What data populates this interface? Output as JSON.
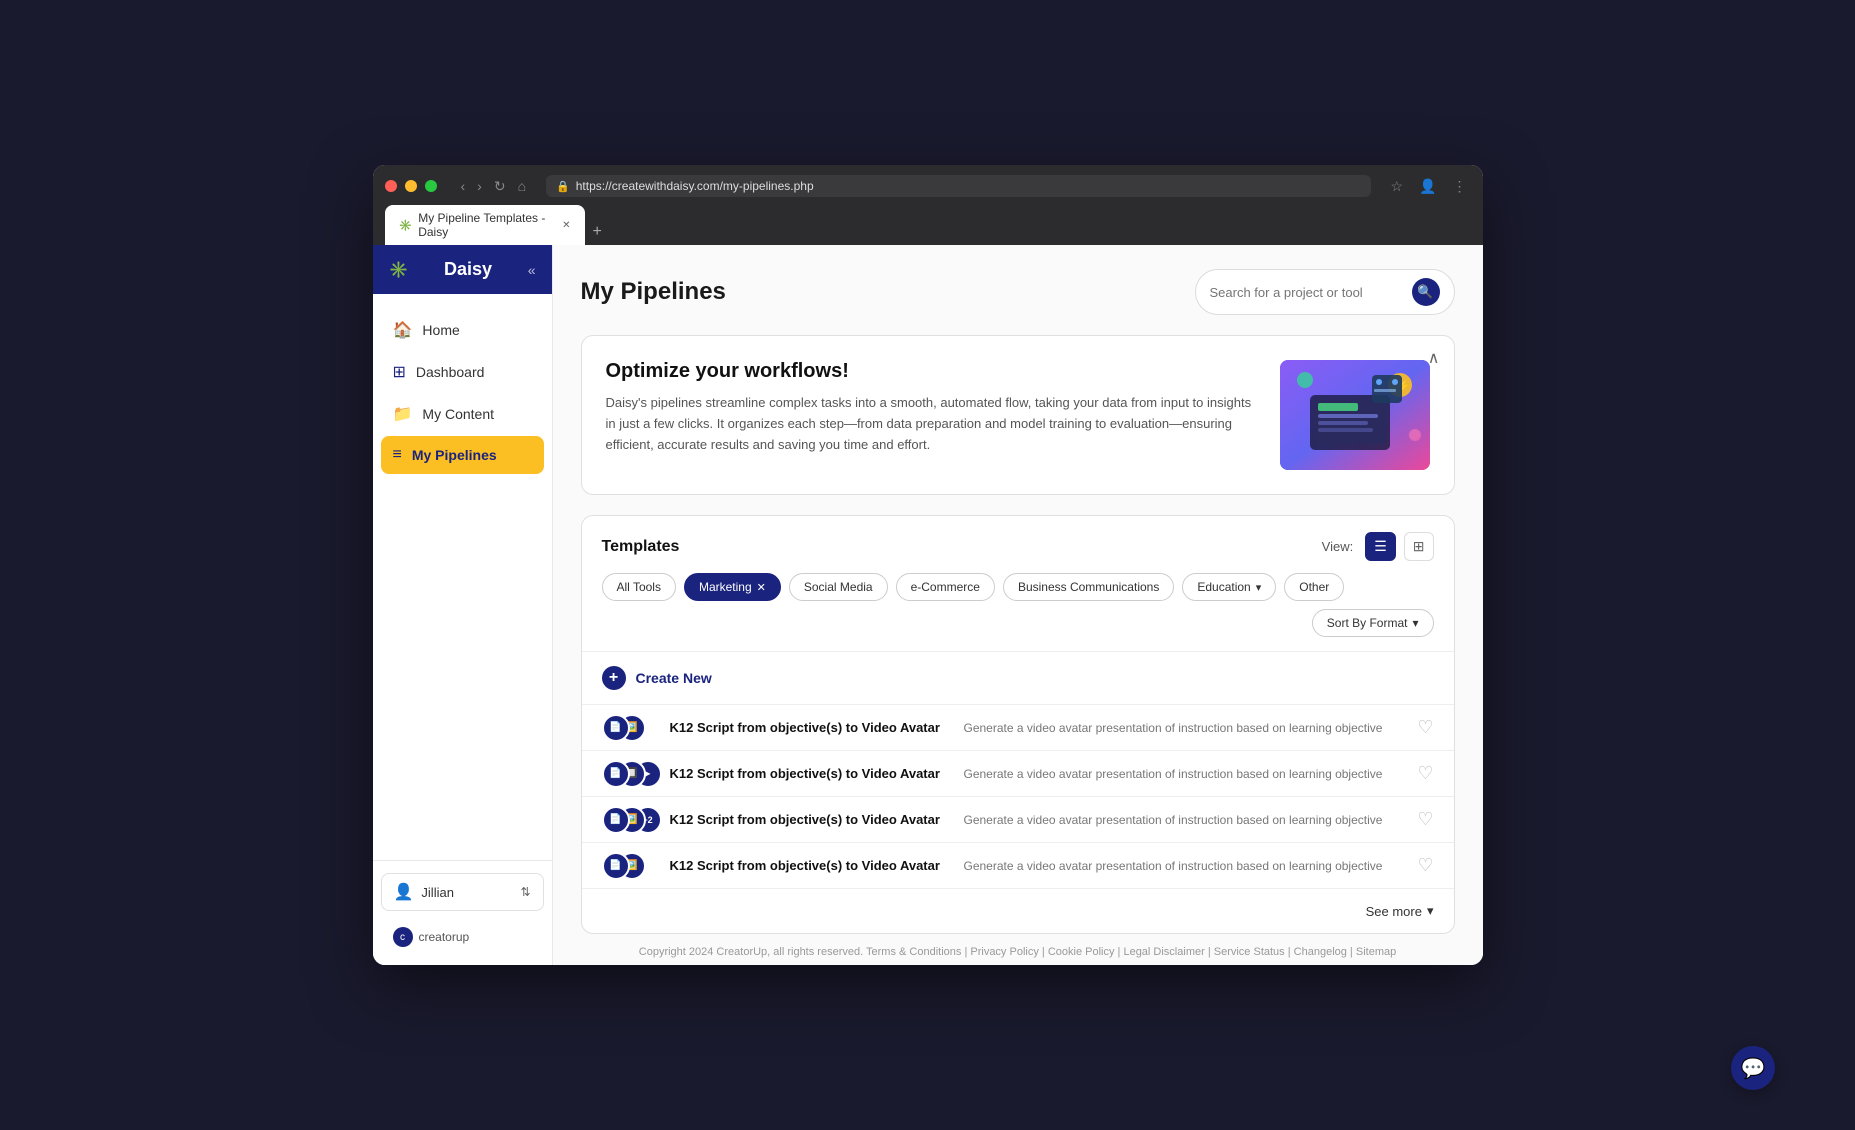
{
  "browser": {
    "url": "https://createwithdaisy.com/my-pipelines.php",
    "tab_title": "My Pipeline Templates - Daisy",
    "favicon": "✳️"
  },
  "sidebar": {
    "logo_text": "Daisy",
    "logo_icon": "✳️",
    "nav_items": [
      {
        "id": "home",
        "label": "Home",
        "icon": "🏠",
        "active": false
      },
      {
        "id": "dashboard",
        "label": "Dashboard",
        "icon": "⊞",
        "active": false
      },
      {
        "id": "my-content",
        "label": "My Content",
        "icon": "📁",
        "active": false
      },
      {
        "id": "my-pipelines",
        "label": "My Pipelines",
        "icon": "≡",
        "active": true
      }
    ],
    "user_name": "Jillian",
    "creatorup_label": "creatorup"
  },
  "page": {
    "title": "My Pipelines",
    "search_placeholder": "Search for a project or tool"
  },
  "banner": {
    "title": "Optimize your workflows!",
    "description": "Daisy's pipelines streamline complex tasks into a smooth, automated flow, taking your data from input to insights in just a few clicks. It organizes each step—from data preparation and model training to evaluation—ensuring efficient, accurate results and saving you time and effort."
  },
  "templates_section": {
    "title": "Templates",
    "view_label": "View:",
    "filters": [
      {
        "id": "all-tools",
        "label": "All Tools",
        "active": false,
        "removable": false,
        "has_arrow": false
      },
      {
        "id": "marketing",
        "label": "Marketing",
        "active": true,
        "removable": true,
        "has_arrow": false
      },
      {
        "id": "social-media",
        "label": "Social Media",
        "active": false,
        "removable": false,
        "has_arrow": false
      },
      {
        "id": "ecommerce",
        "label": "e-Commerce",
        "active": false,
        "removable": false,
        "has_arrow": false
      },
      {
        "id": "business-comm",
        "label": "Business Communications",
        "active": false,
        "removable": false,
        "has_arrow": false
      },
      {
        "id": "education",
        "label": "Education",
        "active": false,
        "removable": false,
        "has_arrow": true
      },
      {
        "id": "other",
        "label": "Other",
        "active": false,
        "removable": false,
        "has_arrow": false
      }
    ],
    "sort_label": "Sort By Format",
    "create_new_label": "Create New",
    "templates": [
      {
        "id": "t1",
        "name": "K12 Script from objective(s) to Video Avatar",
        "description": "Generate a video avatar presentation of instruction based on learning objective",
        "icon_count": 2,
        "icons": [
          "📄",
          "🖼️"
        ]
      },
      {
        "id": "t2",
        "name": "K12 Script from objective(s) to Video Avatar",
        "description": "Generate a video avatar presentation of instruction based on learning objective",
        "icon_count": 3,
        "icons": [
          "📄",
          "🔲",
          "▶️"
        ]
      },
      {
        "id": "t3",
        "name": "K12 Script from objective(s) to Video Avatar",
        "description": "Generate a video avatar presentation of instruction based on learning objective",
        "icon_count": 2,
        "icons": [
          "📄",
          "🖼️"
        ],
        "extra_count": "+2"
      },
      {
        "id": "t4",
        "name": "K12 Script from objective(s) to Video Avatar",
        "description": "Generate a video avatar presentation of instruction based on learning objective",
        "icon_count": 2,
        "icons": [
          "📄",
          "🖼️"
        ]
      }
    ],
    "see_more_label": "See more"
  },
  "footer": {
    "text": "Copyright 2024 CreatorUp, all rights reserved.",
    "links": [
      "Terms & Conditions",
      "Privacy Policy",
      "Cookie Policy",
      "Legal Disclaimer",
      "Service Status",
      "Changelog",
      "Sitemap"
    ]
  }
}
